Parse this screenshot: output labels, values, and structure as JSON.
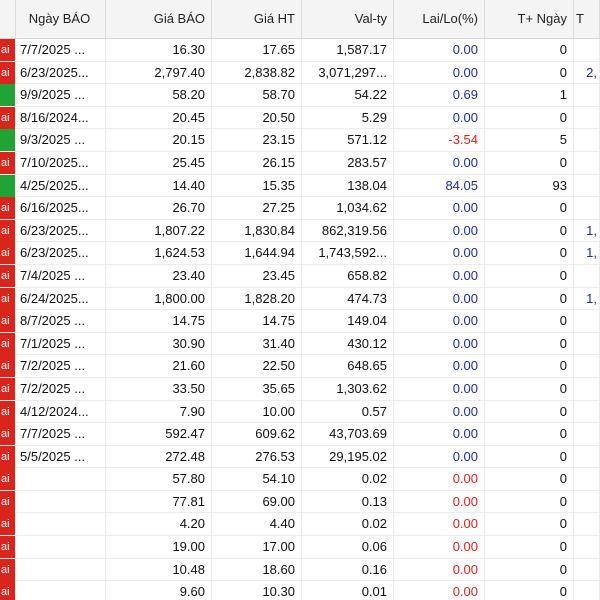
{
  "colors": {
    "red_tag": "#d9251c",
    "green_tag": "#22a336",
    "positive": "#1a2fa0",
    "negative": "#d9251c"
  },
  "columns": [
    "",
    "Ngày BÁO",
    "Giá BÁO",
    "Giá HT",
    "Val-ty",
    "Lai/Lo(%)",
    "T+ Ngày",
    "T"
  ],
  "rows": [
    {
      "tag": "red",
      "tag_text": "ai",
      "date": "7/7/2025 ...",
      "gia_bao": "16.30",
      "gia_ht": "17.65",
      "val": "1,587.17",
      "laylo": "0.00",
      "laylo_color": "blue",
      "tngay": "0",
      "extra": ""
    },
    {
      "tag": "red",
      "tag_text": "ai",
      "date": "6/23/2025...",
      "gia_bao": "2,797.40",
      "gia_ht": "2,838.82",
      "val": "3,071,297...",
      "laylo": "0.00",
      "laylo_color": "blue",
      "tngay": "0",
      "extra": "2,"
    },
    {
      "tag": "green",
      "tag_text": "",
      "date": "9/9/2025 ...",
      "gia_bao": "58.20",
      "gia_ht": "58.70",
      "val": "54.22",
      "laylo": "0.69",
      "laylo_color": "blue",
      "tngay": "1",
      "extra": ""
    },
    {
      "tag": "red",
      "tag_text": "ai",
      "date": "8/16/2024...",
      "gia_bao": "20.45",
      "gia_ht": "20.50",
      "val": "5.29",
      "laylo": "0.00",
      "laylo_color": "blue",
      "tngay": "0",
      "extra": ""
    },
    {
      "tag": "green",
      "tag_text": "",
      "date": "9/3/2025 ...",
      "gia_bao": "20.15",
      "gia_ht": "23.15",
      "val": "571.12",
      "laylo": "-3.54",
      "laylo_color": "red",
      "tngay": "5",
      "extra": ""
    },
    {
      "tag": "red",
      "tag_text": "ai",
      "date": "7/10/2025...",
      "gia_bao": "25.45",
      "gia_ht": "26.15",
      "val": "283.57",
      "laylo": "0.00",
      "laylo_color": "blue",
      "tngay": "0",
      "extra": ""
    },
    {
      "tag": "green",
      "tag_text": "",
      "date": "4/25/2025...",
      "gia_bao": "14.40",
      "gia_ht": "15.35",
      "val": "138.04",
      "laylo": "84.05",
      "laylo_color": "blue",
      "tngay": "93",
      "extra": ""
    },
    {
      "tag": "red",
      "tag_text": "ai",
      "date": "6/16/2025...",
      "gia_bao": "26.70",
      "gia_ht": "27.25",
      "val": "1,034.62",
      "laylo": "0.00",
      "laylo_color": "blue",
      "tngay": "0",
      "extra": ""
    },
    {
      "tag": "red",
      "tag_text": "ai",
      "date": "6/23/2025...",
      "gia_bao": "1,807.22",
      "gia_ht": "1,830.84",
      "val": "862,319.56",
      "laylo": "0.00",
      "laylo_color": "blue",
      "tngay": "0",
      "extra": "1,"
    },
    {
      "tag": "red",
      "tag_text": "ai",
      "date": "6/23/2025...",
      "gia_bao": "1,624.53",
      "gia_ht": "1,644.94",
      "val": "1,743,592...",
      "laylo": "0.00",
      "laylo_color": "blue",
      "tngay": "0",
      "extra": "1,"
    },
    {
      "tag": "red",
      "tag_text": "ai",
      "date": "7/4/2025 ...",
      "gia_bao": "23.40",
      "gia_ht": "23.45",
      "val": "658.82",
      "laylo": "0.00",
      "laylo_color": "blue",
      "tngay": "0",
      "extra": ""
    },
    {
      "tag": "red",
      "tag_text": "ai",
      "date": "6/24/2025...",
      "gia_bao": "1,800.00",
      "gia_ht": "1,828.20",
      "val": "474.73",
      "laylo": "0.00",
      "laylo_color": "blue",
      "tngay": "0",
      "extra": "1,"
    },
    {
      "tag": "red",
      "tag_text": "ai",
      "date": "8/7/2025 ...",
      "gia_bao": "14.75",
      "gia_ht": "14.75",
      "val": "149.04",
      "laylo": "0.00",
      "laylo_color": "blue",
      "tngay": "0",
      "extra": ""
    },
    {
      "tag": "red",
      "tag_text": "ai",
      "date": "7/1/2025 ...",
      "gia_bao": "30.90",
      "gia_ht": "31.40",
      "val": "430.12",
      "laylo": "0.00",
      "laylo_color": "blue",
      "tngay": "0",
      "extra": ""
    },
    {
      "tag": "red",
      "tag_text": "ai",
      "date": "7/2/2025 ...",
      "gia_bao": "21.60",
      "gia_ht": "22.50",
      "val": "648.65",
      "laylo": "0.00",
      "laylo_color": "blue",
      "tngay": "0",
      "extra": ""
    },
    {
      "tag": "red",
      "tag_text": "ai",
      "date": "7/2/2025 ...",
      "gia_bao": "33.50",
      "gia_ht": "35.65",
      "val": "1,303.62",
      "laylo": "0.00",
      "laylo_color": "blue",
      "tngay": "0",
      "extra": ""
    },
    {
      "tag": "red",
      "tag_text": "ai",
      "date": "4/12/2024...",
      "gia_bao": "7.90",
      "gia_ht": "10.00",
      "val": "0.57",
      "laylo": "0.00",
      "laylo_color": "blue",
      "tngay": "0",
      "extra": ""
    },
    {
      "tag": "red",
      "tag_text": "ai",
      "date": "7/7/2025 ...",
      "gia_bao": "592.47",
      "gia_ht": "609.62",
      "val": "43,703.69",
      "laylo": "0.00",
      "laylo_color": "blue",
      "tngay": "0",
      "extra": ""
    },
    {
      "tag": "red",
      "tag_text": "ai",
      "date": "5/5/2025 ...",
      "gia_bao": "272.48",
      "gia_ht": "276.53",
      "val": "29,195.02",
      "laylo": "0.00",
      "laylo_color": "blue",
      "tngay": "0",
      "extra": ""
    },
    {
      "tag": "red",
      "tag_text": "ai",
      "date": "",
      "gia_bao": "57.80",
      "gia_ht": "54.10",
      "val": "0.02",
      "laylo": "0.00",
      "laylo_color": "red",
      "tngay": "0",
      "extra": ""
    },
    {
      "tag": "red",
      "tag_text": "ai",
      "date": "",
      "gia_bao": "77.81",
      "gia_ht": "69.00",
      "val": "0.13",
      "laylo": "0.00",
      "laylo_color": "red",
      "tngay": "0",
      "extra": ""
    },
    {
      "tag": "red",
      "tag_text": "ai",
      "date": "",
      "gia_bao": "4.20",
      "gia_ht": "4.40",
      "val": "0.02",
      "laylo": "0.00",
      "laylo_color": "red",
      "tngay": "0",
      "extra": ""
    },
    {
      "tag": "red",
      "tag_text": "ai",
      "date": "",
      "gia_bao": "19.00",
      "gia_ht": "17.00",
      "val": "0.06",
      "laylo": "0.00",
      "laylo_color": "red",
      "tngay": "0",
      "extra": ""
    },
    {
      "tag": "red",
      "tag_text": "ai",
      "date": "",
      "gia_bao": "10.48",
      "gia_ht": "18.60",
      "val": "0.16",
      "laylo": "0.00",
      "laylo_color": "red",
      "tngay": "0",
      "extra": ""
    },
    {
      "tag": "red",
      "tag_text": "ai",
      "date": "",
      "gia_bao": "9.60",
      "gia_ht": "10.30",
      "val": "0.01",
      "laylo": "0.00",
      "laylo_color": "red",
      "tngay": "0",
      "extra": ""
    }
  ]
}
